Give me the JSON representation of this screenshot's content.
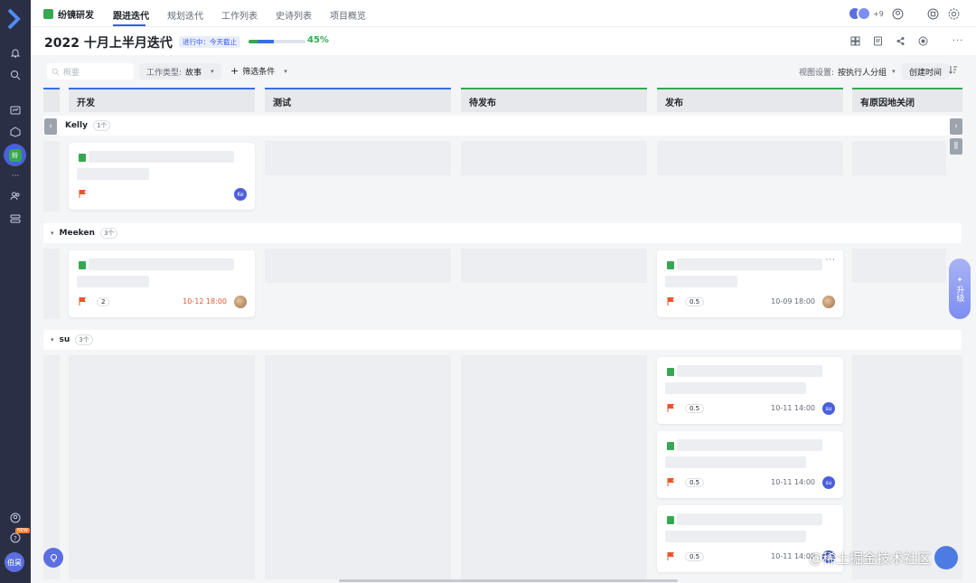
{
  "topnav": {
    "project": "纷镜研发",
    "tabs": [
      "跟进迭代",
      "规划迭代",
      "工作列表",
      "史诗列表",
      "项目概览"
    ],
    "member_count": "+9"
  },
  "sprint": {
    "title": "2022 十月上半月迭代",
    "status": "进行中：今天截止",
    "progress_text": "45%",
    "progress_value": 0.45
  },
  "toolbar": {
    "search_placeholder": "概要",
    "work_type_label": "工作类型:",
    "work_type_value": "故事",
    "filter_label": "筛选条件",
    "view_label": "视图设置:",
    "view_value": "按执行人分组",
    "sort_label": "创建时间"
  },
  "columns": [
    "开发",
    "测试",
    "待发布",
    "发布",
    "有原因地关闭"
  ],
  "groups": [
    {
      "name": "Kelly",
      "count": "1个"
    },
    {
      "name": "Meeken",
      "count": "3个"
    },
    {
      "name": "su",
      "count": "3个"
    }
  ],
  "cards": {
    "kelly_dev": {
      "avatar": "Ke"
    },
    "meeken_dev": {
      "points": "2",
      "due": "10-12 18:00"
    },
    "meeken_release": {
      "points": "0.5",
      "due": "10-09 18:00"
    },
    "su_release_1": {
      "points": "0.5",
      "due": "10-11 14:00",
      "avatar": "su"
    },
    "su_release_2": {
      "points": "0.5",
      "due": "10-11 14:00",
      "avatar": "su"
    },
    "su_release_3": {
      "points": "0.5",
      "due": "10-11 14:00",
      "avatar": "su"
    }
  },
  "sidebar": {
    "active_label": "纷",
    "avatar": "伯昊",
    "new_badge": "NEW"
  },
  "upgrade": {
    "label": "升级"
  },
  "watermark": "@稀土掘金技术社区",
  "colors": {
    "accent": "#3b5bdb",
    "green": "#36a852",
    "flag": "#e8562c",
    "sidebar": "#2a2f45"
  }
}
